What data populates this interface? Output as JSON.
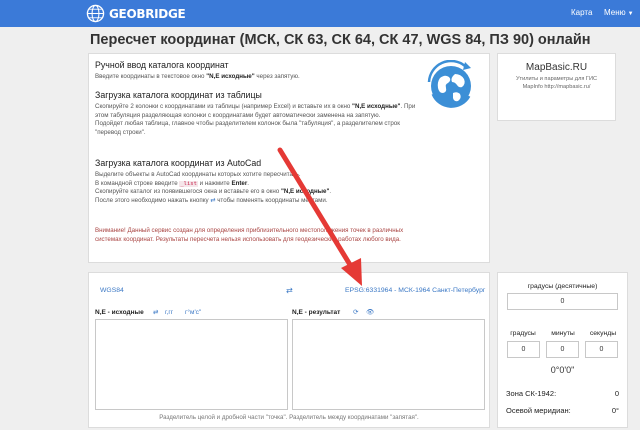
{
  "navbar": {
    "brand": "GEOBRIDGE",
    "map_label": "Карта",
    "menu_label": "Меню",
    "brand_color": "#3b7ad8"
  },
  "page_title": "Пересчет координат (МСК, СК 63, СК 64, СК 47, WGS 84, ПЗ 90) онлайн",
  "info": {
    "manual": {
      "title": "Ручной ввод каталога координат",
      "text_before": "Введите координаты в текстовое окно ",
      "text_bold": "\"N,E исходные\"",
      "text_after": " через запятую."
    },
    "table": {
      "title": "Загрузка каталога координат из таблицы",
      "text1_before": "Скопируйте 2 колонки с координатами из таблицы (например Excel) и вставьте их в окно ",
      "text1_bold": "\"N,E исходные\"",
      "text1_after": ". При этом табуляция разделяющая колонки с координатами будет автоматически заменена на запятую.",
      "text2": "Подойдет любая таблица, главное чтобы разделителем колонок была \"табуляция\", а разделителем строк \"перевод строки\"."
    },
    "autocad": {
      "title": "Загрузка каталога координат из AutoCad",
      "line1": "Выделите объекты в AutoCad координаты которых хотите пересчитать.",
      "line2_before": "В командной строке введите ",
      "line2_code": "_list",
      "line2_middle": " и нажмите ",
      "line2_bold": "Enter",
      "line2_after": ".",
      "line3_before": "Скопируйте каталог из появившегося окна и вставьте его в окно ",
      "line3_bold": "\"N,E исходные\"",
      "line3_after": ".",
      "line4_before": "После этого необходимо нажать кнопку ",
      "line4_after": " чтобы поменять координаты местами."
    },
    "warning": "Внимание! Данный сервис создан для определения приблизительного местоположения точек в различных системах координат. Результаты пересчета нельзя использовать для геодезических работах любого вида."
  },
  "ad": {
    "title": "MapBasic.RU",
    "line1": "Утилиты и параметры для ГИС",
    "line2": "MapInfo http://mapbasic.ru/"
  },
  "converter": {
    "source_system": "WGS84",
    "target_system": "EPSG:6331964 - МСК-1964 Санкт-Петербург",
    "source_label": "N,E - исходные",
    "format_link": "г,гг",
    "dms_link": "г°м'с\"",
    "result_label": "N,E - результат",
    "hint": "Разделитель целой и дробной части \"точка\". Разделитель между координатами \"запятая\"."
  },
  "side": {
    "decimal_label": "градусы (десятичные)",
    "decimal_value": "0",
    "deg_label": "градусы",
    "min_label": "минуты",
    "sec_label": "секунды",
    "deg_value": "0",
    "min_value": "0",
    "sec_value": "0",
    "dms_value": "0°0'0\"",
    "zone_label": "Зона СК-1942:",
    "zone_value": "0",
    "meridian_label": "Осевой меридиан:",
    "meridian_value": "0°"
  }
}
